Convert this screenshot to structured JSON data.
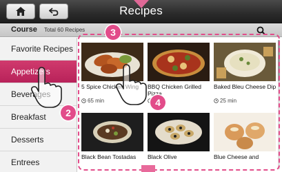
{
  "header": {
    "title": "Recipes",
    "home_icon": "home-icon",
    "back_icon": "back-arrow-icon"
  },
  "course_bar": {
    "label": "Course",
    "count_text": "Total 60 Recipes",
    "search_icon": "search-icon"
  },
  "sidebar": {
    "items": [
      {
        "label": "Favorite Recipes"
      },
      {
        "label": "Appetizers"
      },
      {
        "label": "Beverages"
      },
      {
        "label": "Breakfast"
      },
      {
        "label": "Desserts"
      },
      {
        "label": "Entrees"
      }
    ]
  },
  "recipes": [
    {
      "name": "5 Spice Chicken Wing",
      "time": "65 min"
    },
    {
      "name": "BBQ Chicken Grilled Pizza",
      "time": "min"
    },
    {
      "name": "Baked Bleu Cheese Dip",
      "time": "25 min"
    },
    {
      "name": "Black Bean Tostadas"
    },
    {
      "name": "Black Olive"
    },
    {
      "name": "Blue Cheese and"
    }
  ],
  "callouts": {
    "sidebar": "2",
    "grid": "3",
    "tap": "4"
  },
  "colors": {
    "accent": "#e24c8a",
    "active_item": "#c42e63",
    "header": "#2b2b2b"
  }
}
